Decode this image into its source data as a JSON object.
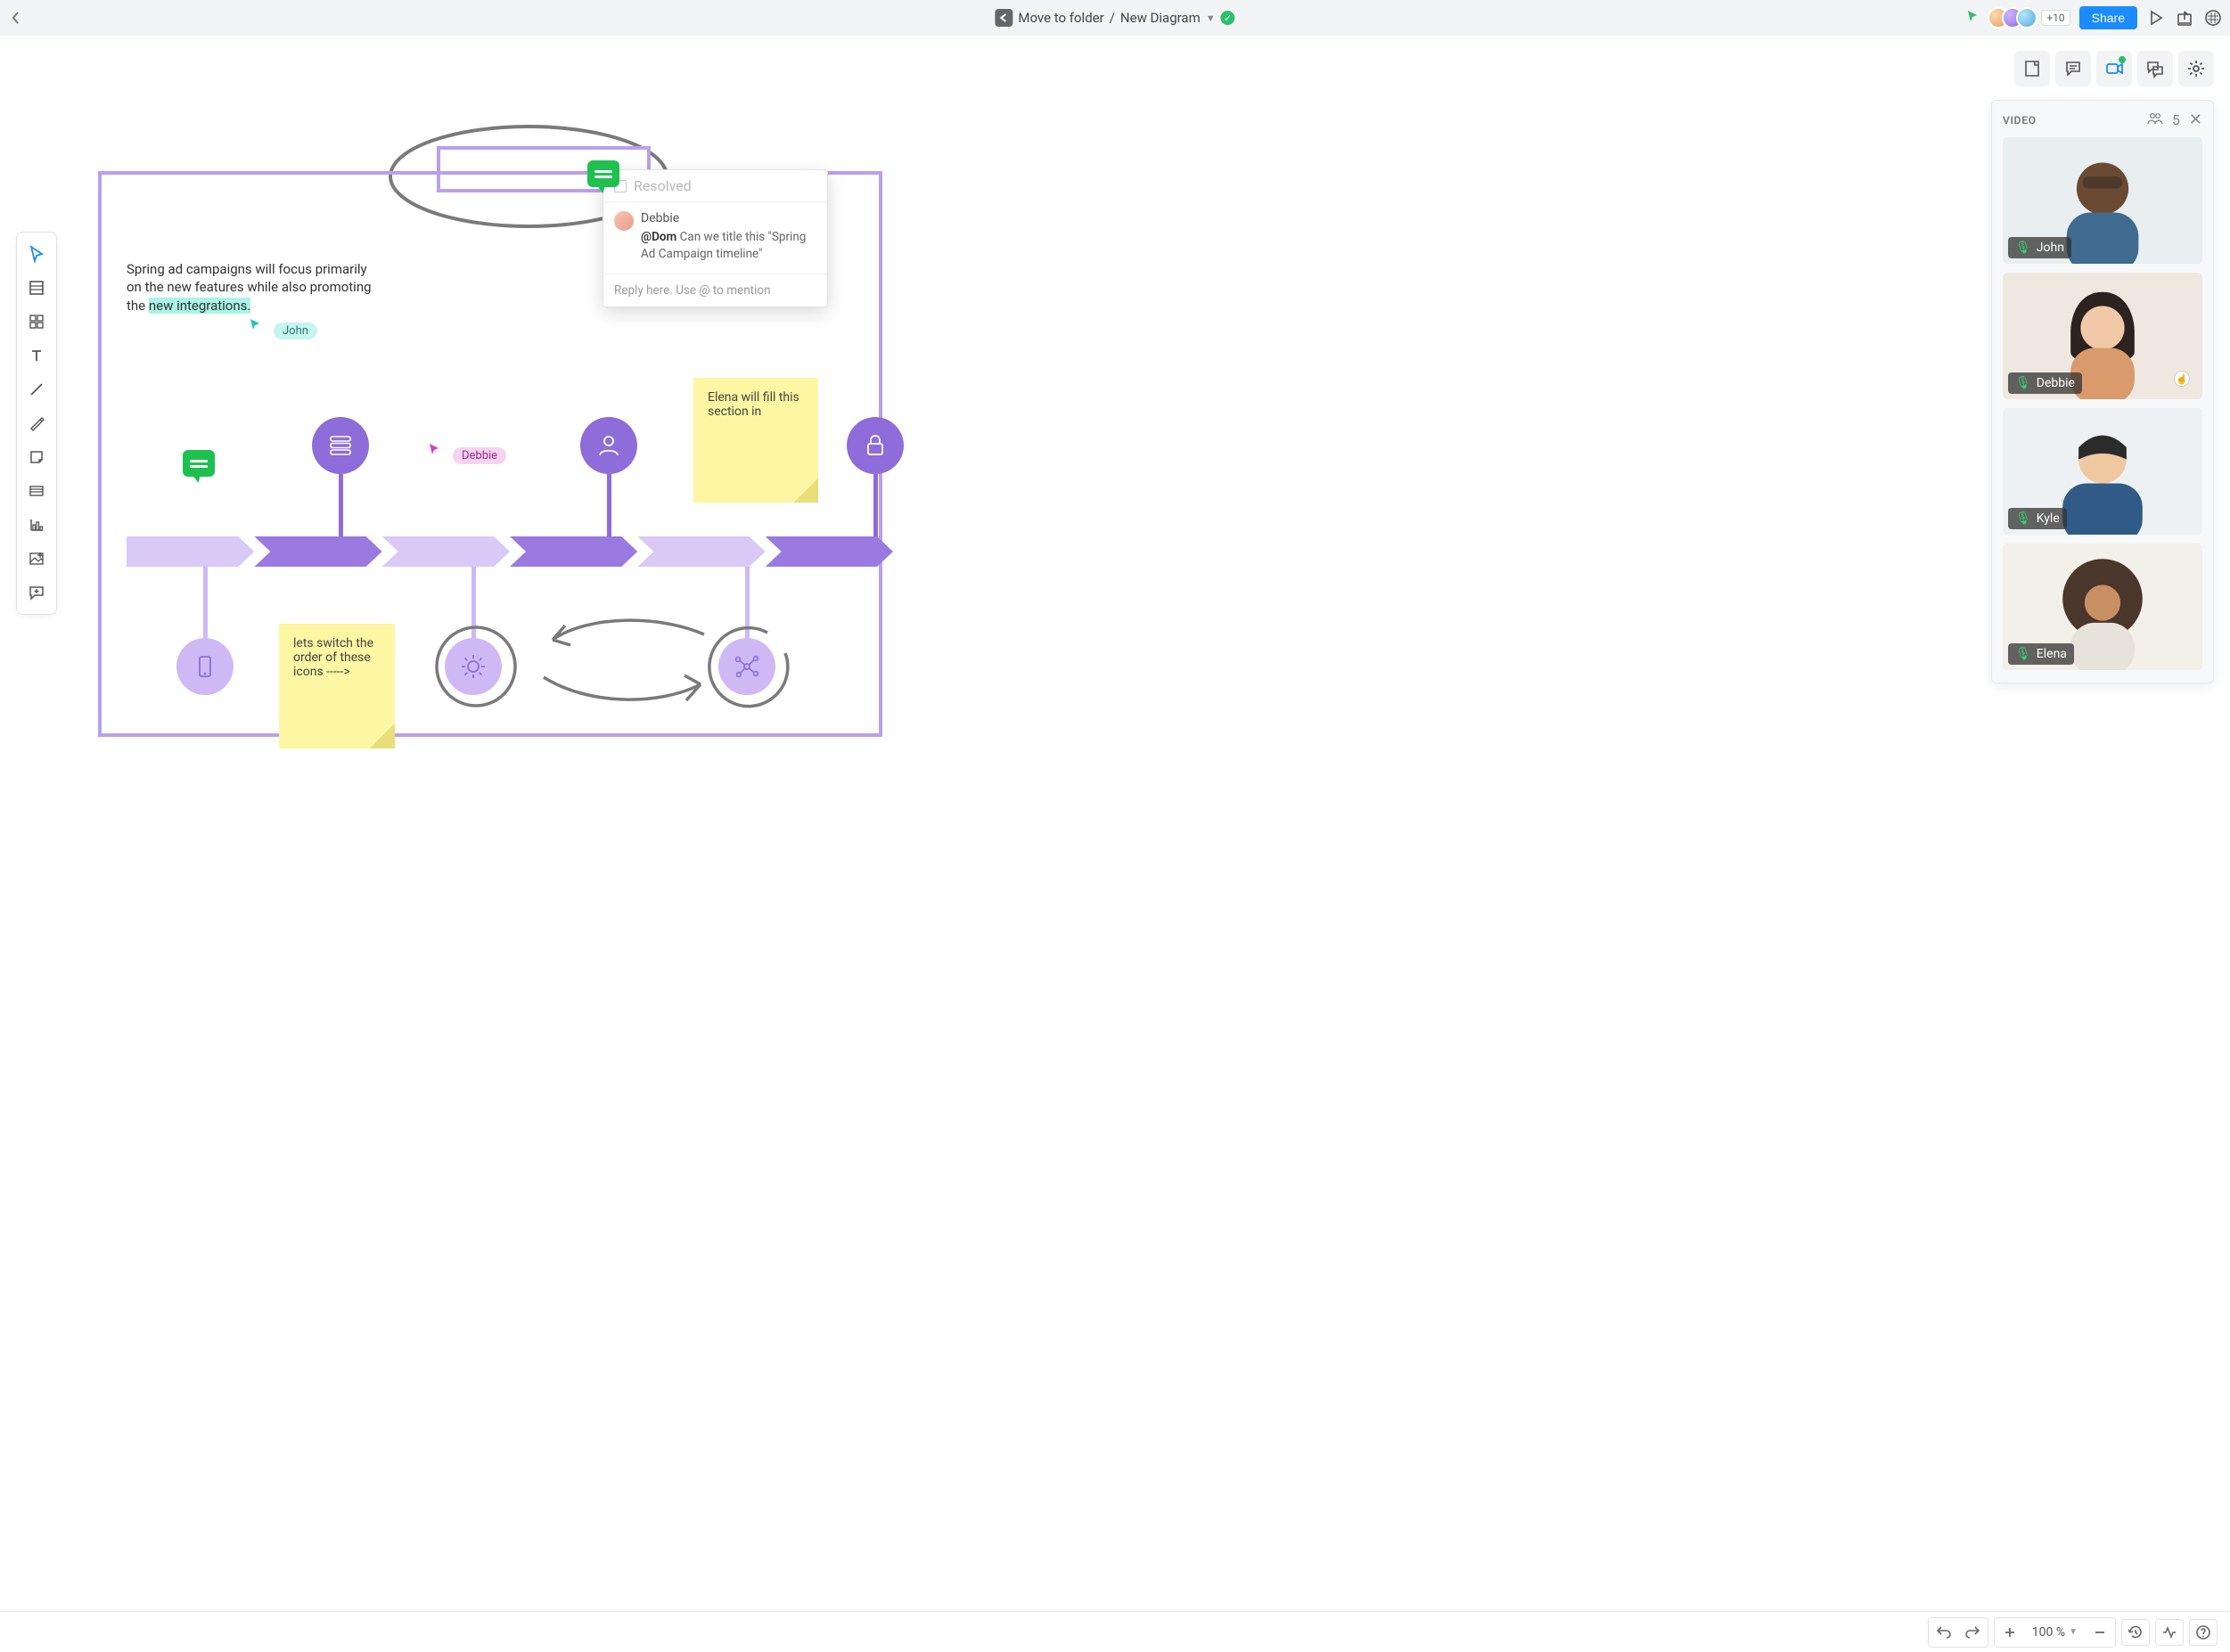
{
  "topbar": {
    "breadcrumb_folder": "Move to folder",
    "breadcrumb_sep": "/",
    "breadcrumb_doc": "New Diagram",
    "avatars_more": "+10",
    "share_label": "Share"
  },
  "video": {
    "title": "VIDEO",
    "count": "5",
    "tiles": [
      {
        "name": "John"
      },
      {
        "name": "Debbie"
      },
      {
        "name": "Kyle"
      },
      {
        "name": "Elena"
      }
    ]
  },
  "canvas": {
    "body_text_pre": "Spring ad campaigns will focus primarily on the new features while also promoting the ",
    "body_text_hl": "new integrations.",
    "cursor_john": "John",
    "cursor_debbie": "Debbie",
    "sticky_elena": "Elena will fill this section in",
    "sticky_switch": "lets switch the order of these icons ----->"
  },
  "comment": {
    "resolved_label": "Resolved",
    "author": "Debbie",
    "mention": "@Dom",
    "message_rest": " Can we title this \"Spring Ad Campaign timeline\"",
    "reply_placeholder": "Reply here. Use @ to mention"
  },
  "bottom": {
    "zoom": "100 %"
  }
}
